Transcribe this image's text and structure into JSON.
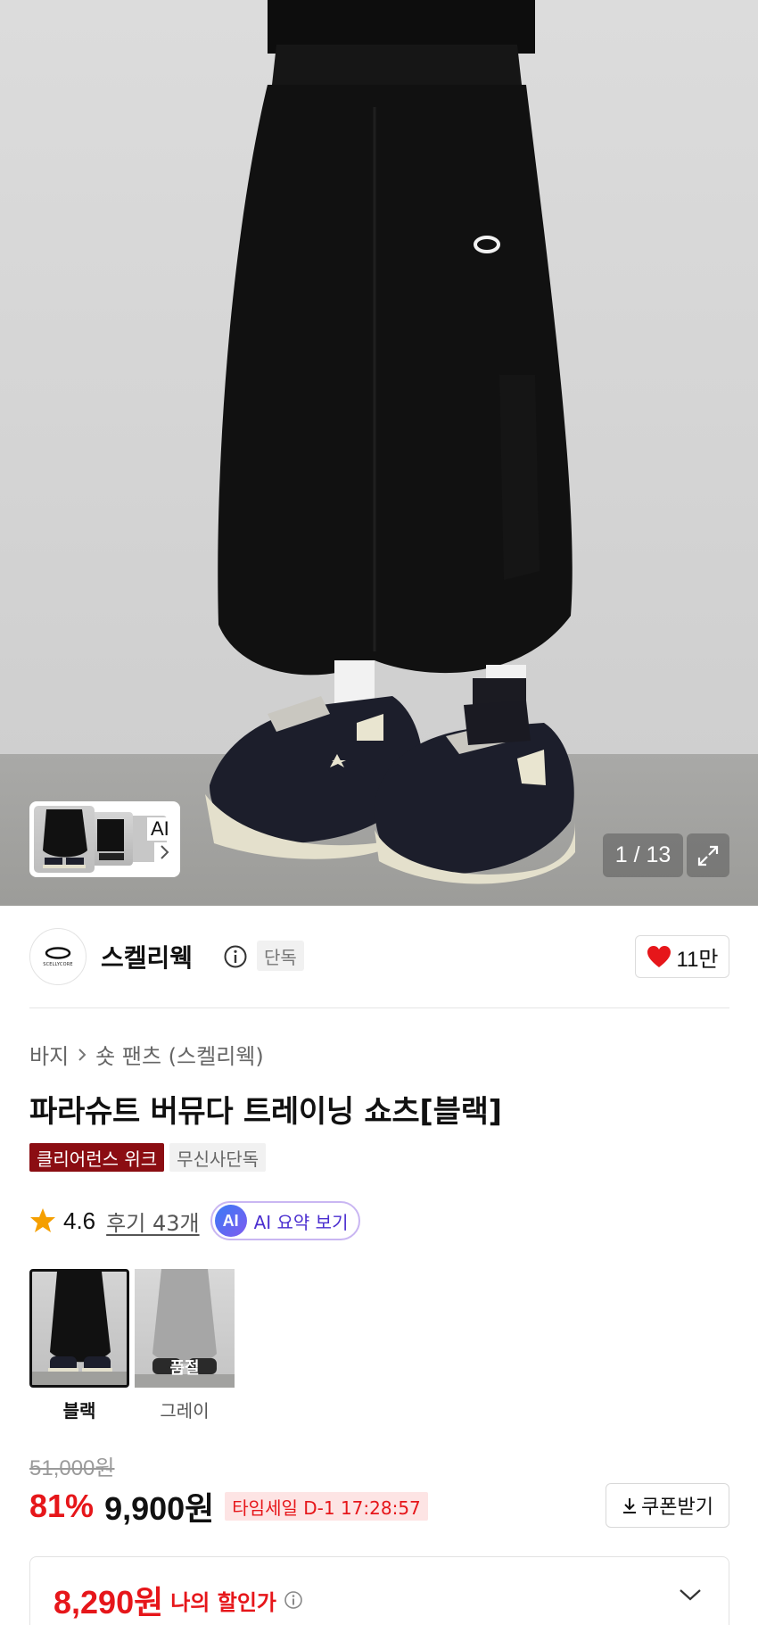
{
  "gallery": {
    "thumb_ai_label": "AI",
    "counter": "1 / 13"
  },
  "brand": {
    "logo_text": "SCELLYCORE",
    "name": "스켈리웩",
    "tag": "단독",
    "likes": "11만"
  },
  "product": {
    "breadcrumbs": [
      "바지",
      "숏 팬츠 (스켈리웩)"
    ],
    "title": "파라슈트 버뮤다 트레이닝 쇼츠[블랙]",
    "badges": [
      "클리어런스 위크",
      "무신사단독"
    ],
    "rating": "4.6",
    "review_link": "후기 43개",
    "ai_summary": {
      "icon_text": "AI",
      "label": "AI 요약 보기"
    }
  },
  "options": [
    {
      "label": "블랙",
      "selected": true,
      "sold_out": ""
    },
    {
      "label": "그레이",
      "selected": false,
      "sold_out": "품절"
    }
  ],
  "pricing": {
    "original": "51,000원",
    "discount": "81%",
    "price": "9,900원",
    "timesale": "타임세일 D-1 17:28:57",
    "coupon_label": "쿠폰받기",
    "my_price": "8,290원",
    "my_price_label": "나의 할인가"
  },
  "colors": {
    "accent_red": "#e6161a",
    "badge_red": "#8b0d12",
    "ai_purple": "#4b2fd0"
  }
}
